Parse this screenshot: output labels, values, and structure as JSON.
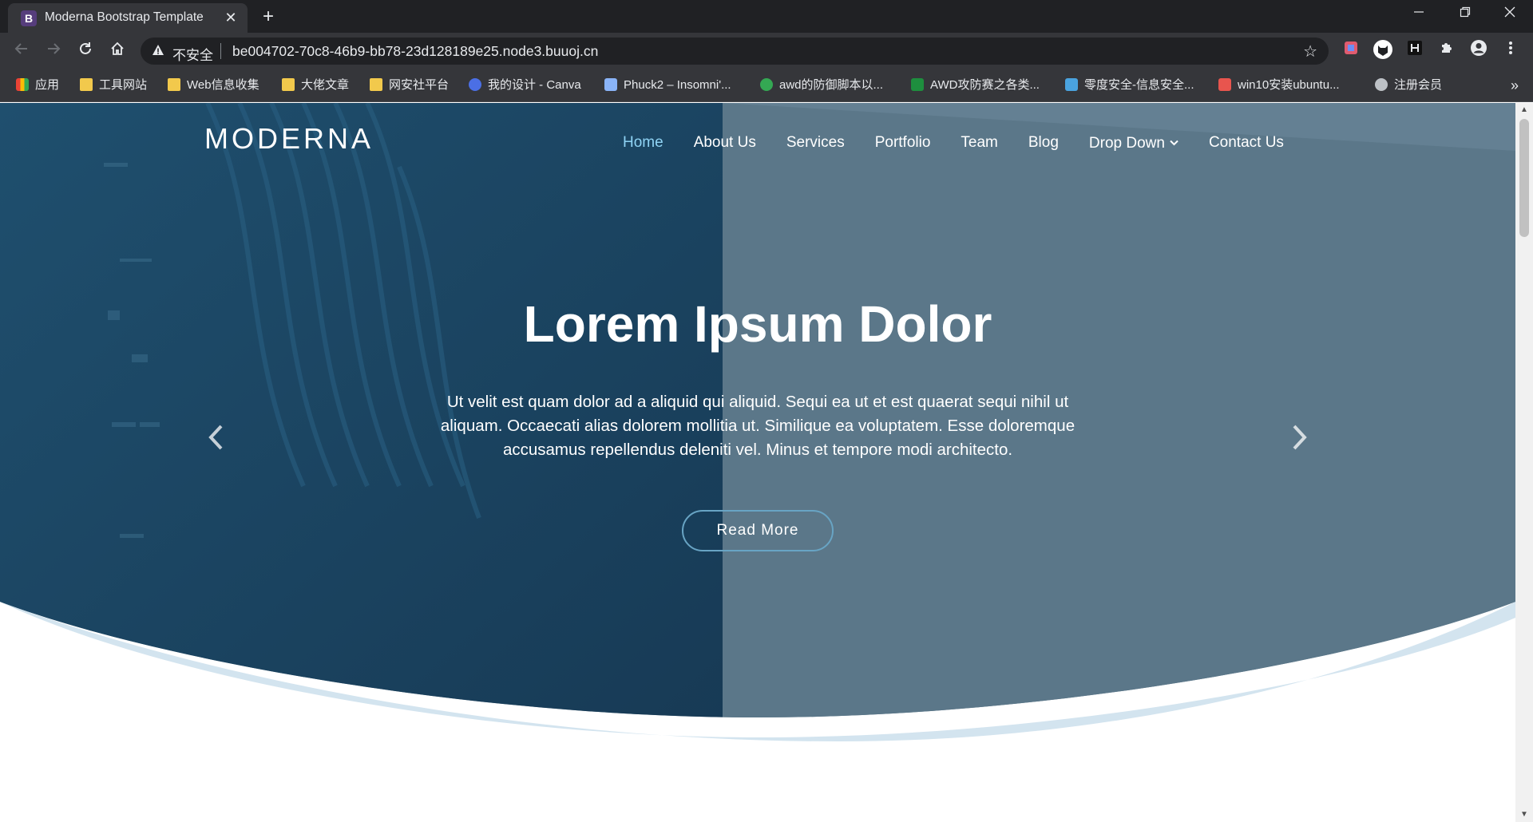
{
  "browser": {
    "tab_title": "Moderna Bootstrap Template",
    "tab_favicon": "B",
    "tab_close": "✕",
    "new_tab": "+",
    "security_label": "不安全",
    "url": "be004702-70c8-46b9-bb78-23d128189e25.node3.buuoj.cn",
    "window_controls": {
      "minimize": "—",
      "restore": "❐",
      "close": "✕"
    }
  },
  "bookmarks": [
    {
      "label": "应用",
      "icon": "apps-icon"
    },
    {
      "label": "工具网站",
      "icon": "folder-icon"
    },
    {
      "label": "Web信息收集",
      "icon": "folder-icon"
    },
    {
      "label": "大佬文章",
      "icon": "folder-icon"
    },
    {
      "label": "网安社平台",
      "icon": "folder-icon"
    },
    {
      "label": "我的设计 - Canva",
      "icon": "canva-icon"
    },
    {
      "label": "Phuck2 – Insomni'...",
      "icon": "page-icon"
    },
    {
      "label": "awd的防御脚本以...",
      "icon": "awd-icon"
    },
    {
      "label": "AWD攻防赛之各类...",
      "icon": "awd-site-icon"
    },
    {
      "label": "零度安全-信息安全...",
      "icon": "zero-icon"
    },
    {
      "label": "win10安装ubuntu...",
      "icon": "jianshu-icon"
    },
    {
      "label": "注册会员",
      "icon": "globe-icon"
    }
  ],
  "bookmarks_more": "»",
  "site": {
    "logo": "MODERNA",
    "nav": [
      {
        "label": "Home",
        "active": true
      },
      {
        "label": "About Us"
      },
      {
        "label": "Services"
      },
      {
        "label": "Portfolio"
      },
      {
        "label": "Team"
      },
      {
        "label": "Blog"
      },
      {
        "label": "Drop Down"
      },
      {
        "label": "Contact Us"
      }
    ],
    "hero": {
      "title": "Lorem Ipsum Dolor",
      "text": "Ut velit est quam dolor ad a aliquid qui aliquid. Sequi ea ut et est quaerat sequi nihil ut aliquam. Occaecati alias dolorem mollitia ut. Similique ea voluptatem. Esse doloremque accusamus repellendus deleniti vel. Minus et tempore modi architecto.",
      "button": "Read More",
      "prev": "‹",
      "next": "›"
    }
  },
  "colors": {
    "hero_dark": "#1d4766",
    "hero_overlay": "#5b7789",
    "wave": "#d3e4ef",
    "accent": "#68a4c4",
    "nav_active": "#8fd3f4"
  }
}
